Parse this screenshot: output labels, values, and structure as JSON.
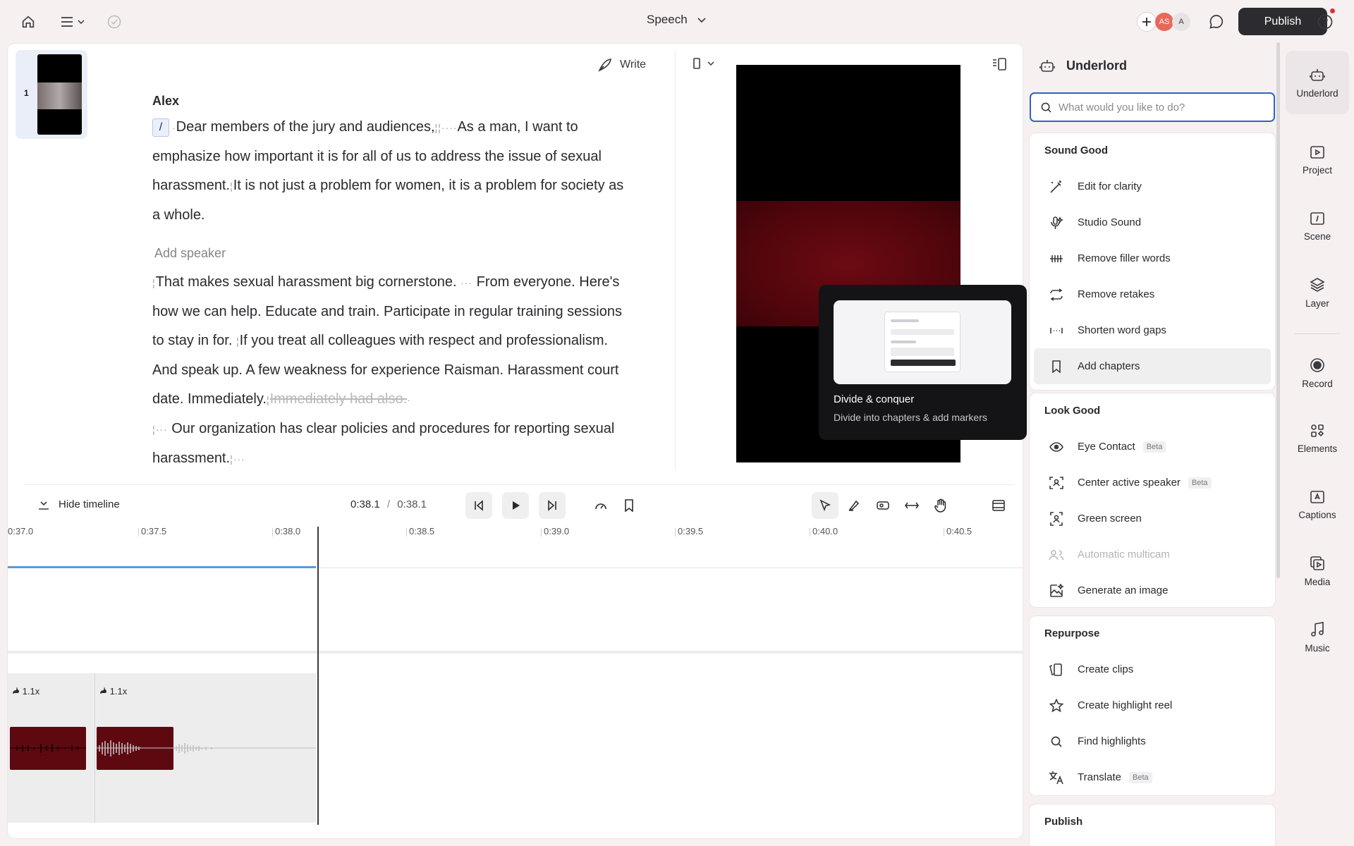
{
  "header": {
    "title": "Speech",
    "publish_label": "Publish",
    "avatars": [
      "AS",
      "A"
    ],
    "accent": "#2c2c30"
  },
  "editor": {
    "scene_number": "1",
    "write_label": "Write",
    "speaker_name": "Alex",
    "slash_token": "/",
    "add_speaker": "Add speaker",
    "p1": [
      "Dear members of the jury and audiences,",
      "As a man, I want to emphasize how important it is for all of us to address the issue of sexual harassment.",
      "It is not just a problem for women, it is a problem for society as a whole."
    ],
    "p2": [
      "That makes sexual harassment big cornerstone.",
      "From everyone. Here's how we can help. Educate and train. Participate in regular training sessions to stay in for.",
      "If you treat all colleagues with respect and professionalism. And speak up. A few weakness for experience Raisman. Harassment court date. Immediately.",
      "Immediately had also.",
      "Our organization has clear policies and procedures for reporting sexual harassment."
    ]
  },
  "tooltip": {
    "title": "Divide & conquer",
    "description": "Divide into chapters & add markers"
  },
  "transport": {
    "hide_timeline": "Hide timeline",
    "current_time": "0:38.1",
    "separator": "/",
    "total_time": "0:38.1"
  },
  "timeline": {
    "ticks": [
      "0:37.0",
      "0:37.5",
      "0:38.0",
      "0:38.5",
      "0:39.0",
      "0:39.5",
      "0:40.0",
      "0:40.5"
    ],
    "speeds": [
      "1.1x",
      "1.1x"
    ],
    "progress_fraction": 0.25
  },
  "underlord": {
    "title": "Underlord",
    "search_placeholder": "What would you like to do?",
    "sections": [
      {
        "title": "Sound Good",
        "items": [
          {
            "label": "Edit for clarity",
            "icon": "wand-icon"
          },
          {
            "label": "Studio Sound",
            "icon": "microphone-sparkle-icon"
          },
          {
            "label": "Remove filler words",
            "icon": "filler-words-icon"
          },
          {
            "label": "Remove retakes",
            "icon": "repeat-icon"
          },
          {
            "label": "Shorten word gaps",
            "icon": "word-gap-icon"
          },
          {
            "label": "Add chapters",
            "icon": "bookmark-icon"
          }
        ]
      },
      {
        "title": "Look Good",
        "items": [
          {
            "label": "Eye Contact",
            "badge": "Beta",
            "icon": "eye-icon"
          },
          {
            "label": "Center active speaker",
            "badge": "Beta",
            "icon": "center-speaker-icon"
          },
          {
            "label": "Green screen",
            "icon": "green-screen-icon"
          },
          {
            "label": "Automatic multicam",
            "icon": "multicam-icon"
          },
          {
            "label": "Generate an image",
            "icon": "image-sparkle-icon"
          }
        ]
      },
      {
        "title": "Repurpose",
        "items": [
          {
            "label": "Create clips",
            "icon": "clips-icon"
          },
          {
            "label": "Create highlight reel",
            "icon": "star-icon"
          },
          {
            "label": "Find highlights",
            "icon": "search-icon"
          },
          {
            "label": "Translate",
            "badge": "Beta",
            "icon": "translate-icon"
          }
        ]
      },
      {
        "title": "Publish",
        "items": []
      }
    ]
  },
  "rail": [
    {
      "label": "Underlord",
      "icon": "robot-icon"
    },
    {
      "label": "Project",
      "icon": "project-icon"
    },
    {
      "label": "Scene",
      "icon": "scene-icon"
    },
    {
      "label": "Layer",
      "icon": "layers-icon"
    },
    {
      "label": "Record",
      "icon": "record-icon"
    },
    {
      "label": "Elements",
      "icon": "elements-icon"
    },
    {
      "label": "Captions",
      "icon": "captions-icon"
    },
    {
      "label": "Media",
      "icon": "media-icon"
    },
    {
      "label": "Music",
      "icon": "music-icon"
    }
  ]
}
